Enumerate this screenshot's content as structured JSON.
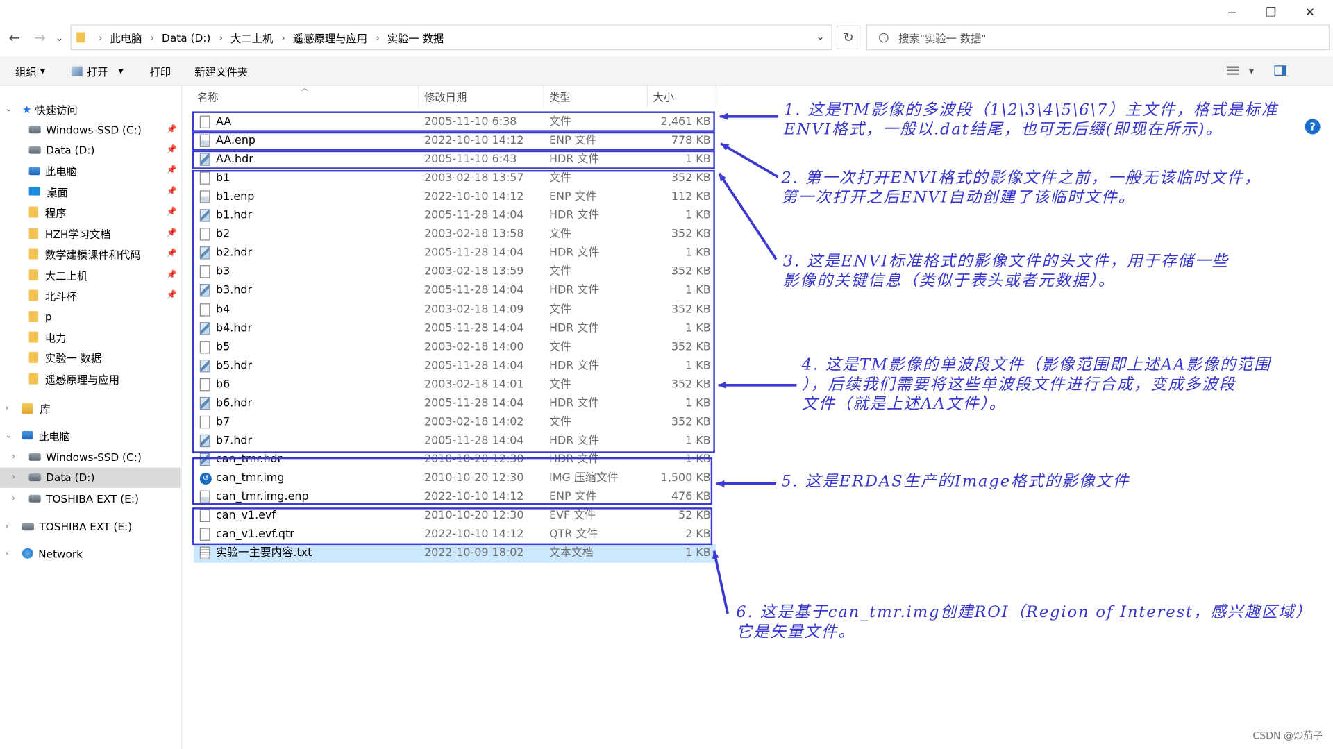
{
  "window": {
    "controls": {
      "minimize": "─",
      "maximize": "❐",
      "close": "✕"
    }
  },
  "nav": {
    "back": "←",
    "forward": "→",
    "recent": "⌄",
    "up": "📁",
    "refresh": "↻",
    "dropdown": "⌄"
  },
  "breadcrumb": [
    "此电脑",
    "Data (D:)",
    "大二上机",
    "遥感原理与应用",
    "实验一 数据"
  ],
  "search": {
    "placeholder": "搜索\"实验一 数据\""
  },
  "toolbar": {
    "organize": "组织",
    "open": "打开",
    "print": "打印",
    "new_folder": "新建文件夹",
    "help": "?"
  },
  "sidebar": {
    "quick_access": "快速访问",
    "items": [
      {
        "label": "Windows-SSD (C:)",
        "icon": "drive-icon",
        "pinned": true
      },
      {
        "label": "Data (D:)",
        "icon": "drive-icon",
        "pinned": true
      },
      {
        "label": "此电脑",
        "icon": "computer-icon",
        "pinned": true
      },
      {
        "label": "桌面",
        "icon": "desktop-icon",
        "pinned": true
      },
      {
        "label": "程序",
        "icon": "folder-icon",
        "pinned": true
      },
      {
        "label": "HZH学习文档",
        "icon": "folder-icon",
        "pinned": true
      },
      {
        "label": "数学建模课件和代码",
        "icon": "folder-icon",
        "pinned": true
      },
      {
        "label": "大二上机",
        "icon": "folder-icon",
        "pinned": true
      },
      {
        "label": "北斗杯",
        "icon": "folder-icon",
        "pinned": true
      },
      {
        "label": "p",
        "icon": "folder-icon",
        "pinned": false
      },
      {
        "label": "电力",
        "icon": "folder-icon",
        "pinned": false
      },
      {
        "label": "实验一 数据",
        "icon": "folder-icon",
        "pinned": false
      },
      {
        "label": "遥感原理与应用",
        "icon": "folder-icon",
        "pinned": false
      }
    ],
    "library": "库",
    "this_pc": "此电脑",
    "this_pc_items": [
      "Windows-SSD (C:)",
      "Data (D:)",
      "TOSHIBA EXT (E:)"
    ],
    "external": "TOSHIBA EXT (E:)",
    "network": "Network"
  },
  "columns": {
    "name": "名称",
    "date": "修改日期",
    "type": "类型",
    "size": "大小"
  },
  "files": [
    {
      "name": "AA",
      "date": "2005-11-10 6:38",
      "type": "文件",
      "size": "2,461 KB",
      "icon": "blank"
    },
    {
      "name": "AA.enp",
      "date": "2022-10-10 14:12",
      "type": "ENP 文件",
      "size": "778 KB",
      "icon": "enp"
    },
    {
      "name": "AA.hdr",
      "date": "2005-11-10 6:43",
      "type": "HDR 文件",
      "size": "1 KB",
      "icon": "hdr"
    },
    {
      "name": "b1",
      "date": "2003-02-18 13:57",
      "type": "文件",
      "size": "352 KB",
      "icon": "blank"
    },
    {
      "name": "b1.enp",
      "date": "2022-10-10 14:12",
      "type": "ENP 文件",
      "size": "112 KB",
      "icon": "enp"
    },
    {
      "name": "b1.hdr",
      "date": "2005-11-28 14:04",
      "type": "HDR 文件",
      "size": "1 KB",
      "icon": "hdr"
    },
    {
      "name": "b2",
      "date": "2003-02-18 13:58",
      "type": "文件",
      "size": "352 KB",
      "icon": "blank"
    },
    {
      "name": "b2.hdr",
      "date": "2005-11-28 14:04",
      "type": "HDR 文件",
      "size": "1 KB",
      "icon": "hdr"
    },
    {
      "name": "b3",
      "date": "2003-02-18 13:59",
      "type": "文件",
      "size": "352 KB",
      "icon": "blank"
    },
    {
      "name": "b3.hdr",
      "date": "2005-11-28 14:04",
      "type": "HDR 文件",
      "size": "1 KB",
      "icon": "hdr"
    },
    {
      "name": "b4",
      "date": "2003-02-18 14:09",
      "type": "文件",
      "size": "352 KB",
      "icon": "blank"
    },
    {
      "name": "b4.hdr",
      "date": "2005-11-28 14:04",
      "type": "HDR 文件",
      "size": "1 KB",
      "icon": "hdr"
    },
    {
      "name": "b5",
      "date": "2003-02-18 14:00",
      "type": "文件",
      "size": "352 KB",
      "icon": "blank"
    },
    {
      "name": "b5.hdr",
      "date": "2005-11-28 14:04",
      "type": "HDR 文件",
      "size": "1 KB",
      "icon": "hdr"
    },
    {
      "name": "b6",
      "date": "2003-02-18 14:01",
      "type": "文件",
      "size": "352 KB",
      "icon": "blank"
    },
    {
      "name": "b6.hdr",
      "date": "2005-11-28 14:04",
      "type": "HDR 文件",
      "size": "1 KB",
      "icon": "hdr"
    },
    {
      "name": "b7",
      "date": "2003-02-18 14:02",
      "type": "文件",
      "size": "352 KB",
      "icon": "blank"
    },
    {
      "name": "b7.hdr",
      "date": "2005-11-28 14:04",
      "type": "HDR 文件",
      "size": "1 KB",
      "icon": "hdr"
    },
    {
      "name": "can_tmr.hdr",
      "date": "2010-10-20 12:30",
      "type": "HDR 文件",
      "size": "1 KB",
      "icon": "hdr"
    },
    {
      "name": "can_tmr.img",
      "date": "2010-10-20 12:30",
      "type": "IMG 压缩文件",
      "size": "1,500 KB",
      "icon": "img"
    },
    {
      "name": "can_tmr.img.enp",
      "date": "2022-10-10 14:12",
      "type": "ENP 文件",
      "size": "476 KB",
      "icon": "enp"
    },
    {
      "name": "can_v1.evf",
      "date": "2010-10-20 12:30",
      "type": "EVF 文件",
      "size": "52 KB",
      "icon": "blank"
    },
    {
      "name": "can_v1.evf.qtr",
      "date": "2022-10-10 14:12",
      "type": "QTR 文件",
      "size": "2 KB",
      "icon": "blank"
    },
    {
      "name": "实验一主要内容.txt",
      "date": "2022-10-09 18:02",
      "type": "文本文档",
      "size": "1 KB",
      "icon": "txt",
      "selected": true
    }
  ],
  "annotations": [
    {
      "lines": [
        "1. 这是TM影像的多波段（1\\2\\3\\4\\5\\6\\7）主文件，格式是标准",
        "ENVI格式，一般以.dat结尾，也可无后缀(即现在所示)。"
      ]
    },
    {
      "lines": [
        "2. 第一次打开ENVI格式的影像文件之前，一般无该临时文件，",
        "第一次打开之后ENVI自动创建了该临时文件。"
      ]
    },
    {
      "lines": [
        "3. 这是ENVI标准格式的影像文件的头文件，用于存储一些",
        "影像的关键信息（类似于表头或者元数据）。"
      ]
    },
    {
      "lines": [
        "4. 这是TM影像的单波段文件（影像范围即上述AA影像的范围",
        "），后续我们需要将这些单波段文件进行合成，变成多波段",
        "文件（就是上述AA文件）。"
      ]
    },
    {
      "lines": [
        "5. 这是ERDAS生产的Image格式的影像文件"
      ]
    },
    {
      "lines": [
        "6. 这是基于can_tmr.img创建ROI（Region of Interest，感兴趣区域）",
        "它是矢量文件。"
      ]
    }
  ],
  "watermark": "CSDN @炒茄子",
  "colors": {
    "annotation": "#3a3ad0",
    "selected_row": "#cce8ff",
    "toolbar_bg": "#f4f4f4"
  }
}
